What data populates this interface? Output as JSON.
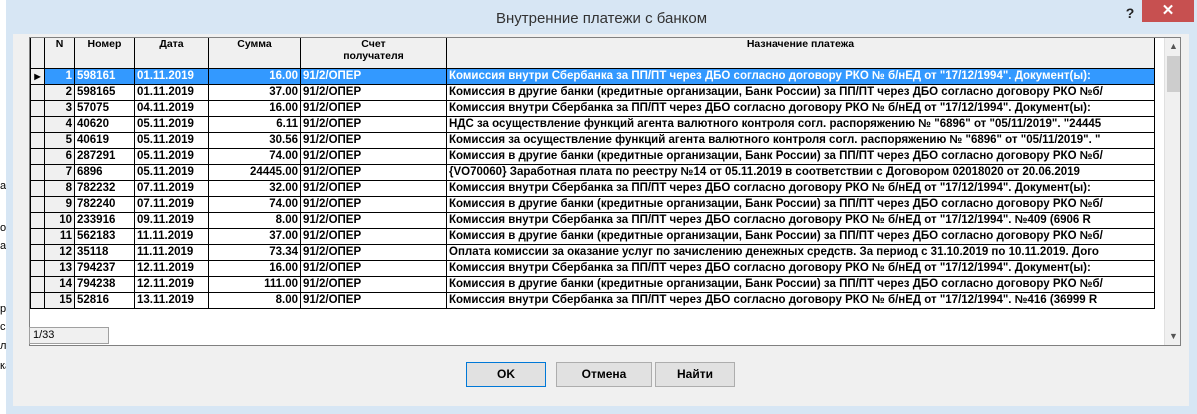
{
  "window": {
    "title": "Внутренние платежи с банком",
    "help": "?",
    "close": "✕"
  },
  "background": {
    "fragments": [
      "ав",
      "ос",
      "а)",
      "ра",
      "сс",
      "ле",
      "ка"
    ]
  },
  "columns": {
    "n": "N",
    "nomer": "Номер",
    "data": "Дата",
    "summa": "Сумма",
    "schet": "Счет получателя",
    "naznachenie": "Назначение платежа"
  },
  "rows": [
    {
      "n": "1",
      "nomer": "598161",
      "data": "01.11.2019",
      "summa": "16.00",
      "schet": "91/2/ОПЕР",
      "naznachenie": "Комиссия внутри Сбербанка за ПП/ПТ через ДБО согласно договору РКО № б/нЕД от \"17/12/1994\". Документ(ы):"
    },
    {
      "n": "2",
      "nomer": "598165",
      "data": "01.11.2019",
      "summa": "37.00",
      "schet": "91/2/ОПЕР",
      "naznachenie": "Комиссия в другие банки (кредитные организации, Банк России) за ПП/ПТ через ДБО согласно договору РКО №б/"
    },
    {
      "n": "3",
      "nomer": "57075",
      "data": "04.11.2019",
      "summa": "16.00",
      "schet": "91/2/ОПЕР",
      "naznachenie": "Комиссия внутри Сбербанка за ПП/ПТ через ДБО согласно договору РКО № б/нЕД от \"17/12/1994\". Документ(ы):"
    },
    {
      "n": "4",
      "nomer": "40620",
      "data": "05.11.2019",
      "summa": "6.11",
      "schet": "91/2/ОПЕР",
      "naznachenie": "НДС за осуществление функций агента валютного контроля согл. распоряжению № \"6896\" от \"05/11/2019\". \"24445"
    },
    {
      "n": "5",
      "nomer": "40619",
      "data": "05.11.2019",
      "summa": "30.56",
      "schet": "91/2/ОПЕР",
      "naznachenie": "Комиссия за осуществление функций агента валютного контроля согл. распоряжению № \"6896\" от \"05/11/2019\". \""
    },
    {
      "n": "6",
      "nomer": "287291",
      "data": "05.11.2019",
      "summa": "74.00",
      "schet": "91/2/ОПЕР",
      "naznachenie": "Комиссия в другие банки (кредитные организации, Банк России) за ПП/ПТ через ДБО согласно договору РКО №б/"
    },
    {
      "n": "7",
      "nomer": "6896",
      "data": "05.11.2019",
      "summa": "24445.00",
      "schet": "91/2/ОПЕР",
      "naznachenie": "{VO70060} Заработная плата по реестру №14 от 05.11.2019 в соответствии с Договором 02018020 от 20.06.2019"
    },
    {
      "n": "8",
      "nomer": "782232",
      "data": "07.11.2019",
      "summa": "32.00",
      "schet": "91/2/ОПЕР",
      "naznachenie": "Комиссия внутри Сбербанка за ПП/ПТ через ДБО согласно договору РКО № б/нЕД от \"17/12/1994\". Документ(ы):"
    },
    {
      "n": "9",
      "nomer": "782240",
      "data": "07.11.2019",
      "summa": "74.00",
      "schet": "91/2/ОПЕР",
      "naznachenie": "Комиссия в другие банки (кредитные организации, Банк России) за ПП/ПТ через ДБО согласно договору РКО №б/"
    },
    {
      "n": "10",
      "nomer": "233916",
      "data": "09.11.2019",
      "summa": "8.00",
      "schet": "91/2/ОПЕР",
      "naznachenie": "Комиссия внутри Сбербанка за ПП/ПТ через ДБО согласно договору РКО № б/нЕД от \"17/12/1994\". №409 (6906 R"
    },
    {
      "n": "11",
      "nomer": "562183",
      "data": "11.11.2019",
      "summa": "37.00",
      "schet": "91/2/ОПЕР",
      "naznachenie": "Комиссия в другие банки (кредитные организации, Банк России) за ПП/ПТ через ДБО согласно договору РКО №б/"
    },
    {
      "n": "12",
      "nomer": "35118",
      "data": "11.11.2019",
      "summa": "73.34",
      "schet": "91/2/ОПЕР",
      "naznachenie": "Оплата комиссии за оказание услуг по зачислению денежных средств. За период с 31.10.2019 по 10.11.2019. Дого"
    },
    {
      "n": "13",
      "nomer": "794237",
      "data": "12.11.2019",
      "summa": "16.00",
      "schet": "91/2/ОПЕР",
      "naznachenie": "Комиссия внутри Сбербанка за ПП/ПТ через ДБО согласно договору РКО № б/нЕД от \"17/12/1994\". Документ(ы):"
    },
    {
      "n": "14",
      "nomer": "794238",
      "data": "12.11.2019",
      "summa": "111.00",
      "schet": "91/2/ОПЕР",
      "naznachenie": "Комиссия в другие банки (кредитные организации, Банк России) за ПП/ПТ через ДБО согласно договору РКО №б/"
    },
    {
      "n": "15",
      "nomer": "52816",
      "data": "13.11.2019",
      "summa": "8.00",
      "schet": "91/2/ОПЕР",
      "naznachenie": "Комиссия внутри Сбербанка за ПП/ПТ через ДБО согласно договору РКО № б/нЕД от \"17/12/1994\". №416 (36999 R"
    }
  ],
  "selected_row": 1,
  "status": {
    "counter": "1/33"
  },
  "buttons": {
    "ok": "OK",
    "cancel": "Отмена",
    "find": "Найти"
  }
}
